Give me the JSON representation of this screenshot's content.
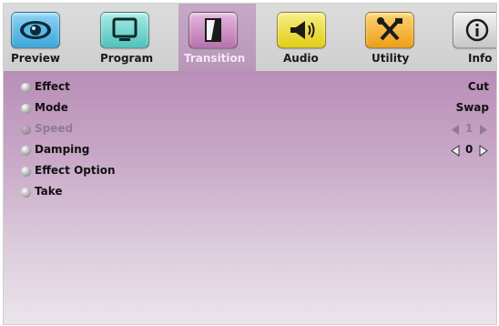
{
  "tabs": [
    {
      "label": "Preview",
      "icon": "eye-icon",
      "color": "#5cb8e6"
    },
    {
      "label": "Program",
      "icon": "monitor-icon",
      "color": "#6fd0cc"
    },
    {
      "label": "Transition",
      "icon": "transition-icon",
      "color": "#c88ac0",
      "active": true
    },
    {
      "label": "Audio",
      "icon": "megaphone-icon",
      "color": "#ecd92c"
    },
    {
      "label": "Utility",
      "icon": "tools-icon",
      "color": "#f2b02a"
    },
    {
      "label": "Info",
      "icon": "info-icon",
      "color": "#d8d8d8"
    }
  ],
  "menu": [
    {
      "label": "Effect",
      "value": "Cut"
    },
    {
      "label": "Mode",
      "value": "Swap"
    },
    {
      "label": "Speed",
      "value": "1",
      "disabled": true
    },
    {
      "label": "Damping",
      "value": "0"
    },
    {
      "label": "Effect Option",
      "value": ""
    },
    {
      "label": "Take",
      "value": ""
    }
  ],
  "colors": {
    "active_tab": "#b896b9",
    "content_top": "#b88eb8",
    "content_bottom": "#ebe4eb"
  }
}
